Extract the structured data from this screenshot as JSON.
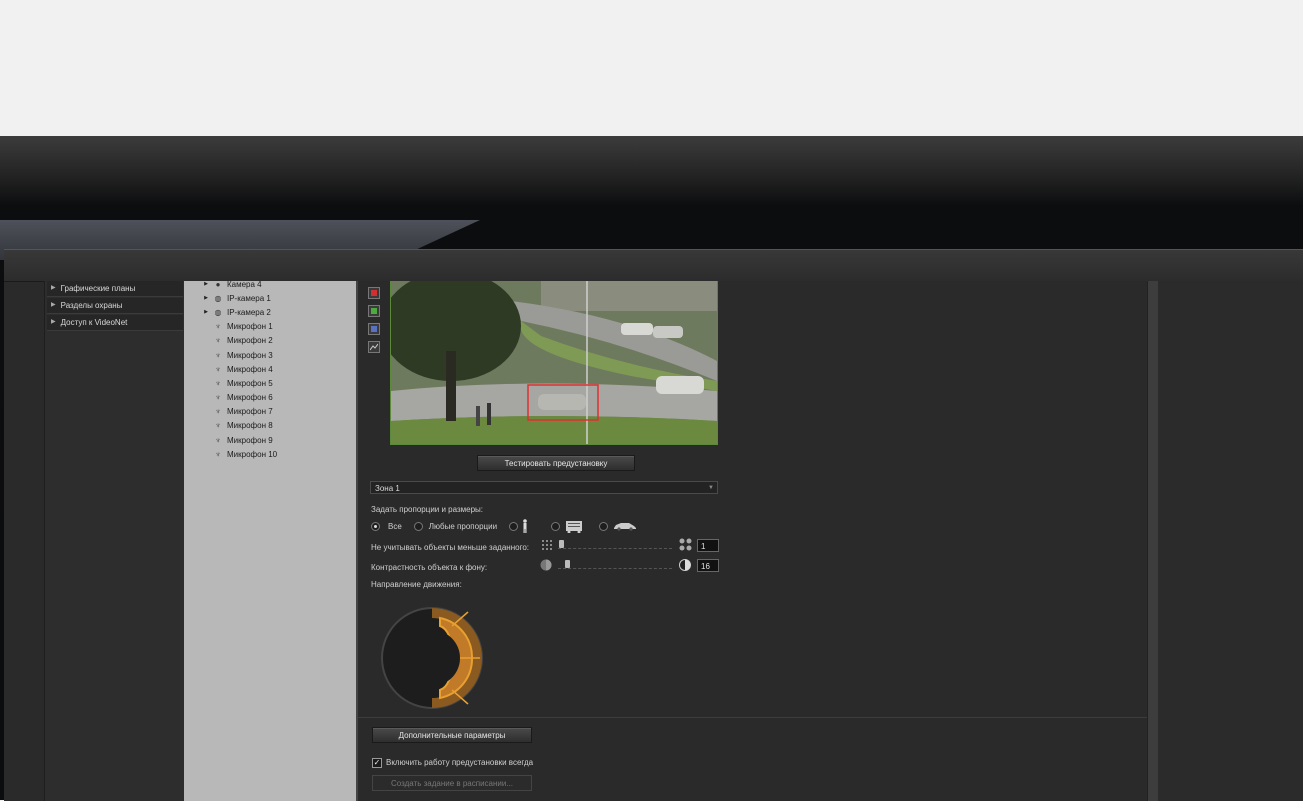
{
  "left_nav": {
    "items": [
      {
        "label": "Графические планы"
      },
      {
        "label": "Разделы охраны"
      },
      {
        "label": "Доступ к VideoNet"
      }
    ]
  },
  "tree": {
    "items": [
      {
        "label": "Камера 4",
        "icon": "camera-icon",
        "expandable": true
      },
      {
        "label": "IP-камера 1",
        "icon": "ip-camera-icon",
        "expandable": true
      },
      {
        "label": "IP-камера 2",
        "icon": "ip-camera-icon",
        "expandable": true
      },
      {
        "label": "Микрофон 1",
        "icon": "microphone-icon",
        "expandable": false
      },
      {
        "label": "Микрофон 2",
        "icon": "microphone-icon",
        "expandable": false
      },
      {
        "label": "Микрофон 3",
        "icon": "microphone-icon",
        "expandable": false
      },
      {
        "label": "Микрофон 4",
        "icon": "microphone-icon",
        "expandable": false
      },
      {
        "label": "Микрофон 5",
        "icon": "microphone-icon",
        "expandable": false
      },
      {
        "label": "Микрофон 6",
        "icon": "microphone-icon",
        "expandable": false
      },
      {
        "label": "Микрофон 7",
        "icon": "microphone-icon",
        "expandable": false
      },
      {
        "label": "Микрофон 8",
        "icon": "microphone-icon",
        "expandable": false
      },
      {
        "label": "Микрофон 9",
        "icon": "microphone-icon",
        "expandable": false
      },
      {
        "label": "Микрофон 10",
        "icon": "microphone-icon",
        "expandable": false
      }
    ]
  },
  "main": {
    "tool_colors": [
      "#d03030",
      "#4caa40",
      "#5a70c0"
    ],
    "test_button": "Тестировать предустановку",
    "zone_select": "Зона 1",
    "proportions_label": "Задать пропорции и размеры:",
    "radio_all": "Все",
    "radio_any": "Любые пропорции",
    "min_size_label": "Не учитывать объекты меньше заданного:",
    "min_size_value": "1",
    "min_size_level": 0.01,
    "contrast_label": "Контрастность объекта к фону:",
    "contrast_value": "16",
    "contrast_level": 0.06,
    "direction_label": "Направление движения:",
    "advanced_button": "Дополнительные параметры",
    "always_on_label": "Включить работу предустановки всегда",
    "always_on_checked": true,
    "schedule_button": "Создать задание в расписании...",
    "accent_color": "#e8a030"
  }
}
